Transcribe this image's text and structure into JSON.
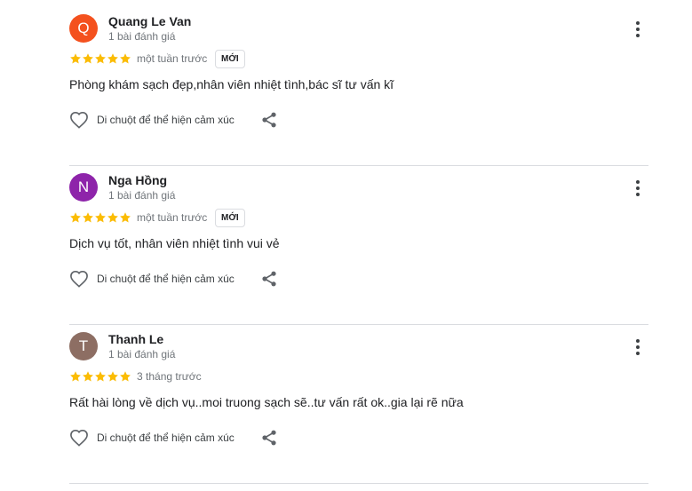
{
  "reviews": [
    {
      "avatar_letter": "Q",
      "avatar_color": "#f4511e",
      "author": "Quang Le Van",
      "review_count": "1 bài đánh giá",
      "rating": 5,
      "time": "một tuần trước",
      "badge": "MỚI",
      "text": "Phòng khám sạch đẹp,nhân viên nhiệt tình,bác sĩ tư vấn kĩ",
      "react_label": "Di chuột để thể hiện cảm xúc"
    },
    {
      "avatar_letter": "N",
      "avatar_color": "#8e24aa",
      "author": "Nga Hồng",
      "review_count": "1 bài đánh giá",
      "rating": 5,
      "time": "một tuần trước",
      "badge": "MỚI",
      "text": "Dịch vụ tốt, nhân viên nhiệt tình vui vẻ",
      "react_label": "Di chuột để thể hiện cảm xúc"
    },
    {
      "avatar_letter": "T",
      "avatar_color": "#8d6e63",
      "author": "Thanh Le",
      "review_count": "1 bài đánh giá",
      "rating": 5,
      "time": "3 tháng trước",
      "badge": "",
      "text": "Rất hài lòng về dịch vụ..moi truong sạch sẽ..tư vấn rất ok..gia lại rẽ nữa",
      "react_label": "Di chuột để thể hiện cảm xúc"
    }
  ],
  "colors": {
    "star": "#fbbc04",
    "icon": "#5f6368",
    "divider": "#dadce0"
  },
  "icons": {
    "more": "more-vert-icon",
    "star": "star-icon",
    "heart": "heart-outline-icon",
    "share": "share-icon"
  }
}
